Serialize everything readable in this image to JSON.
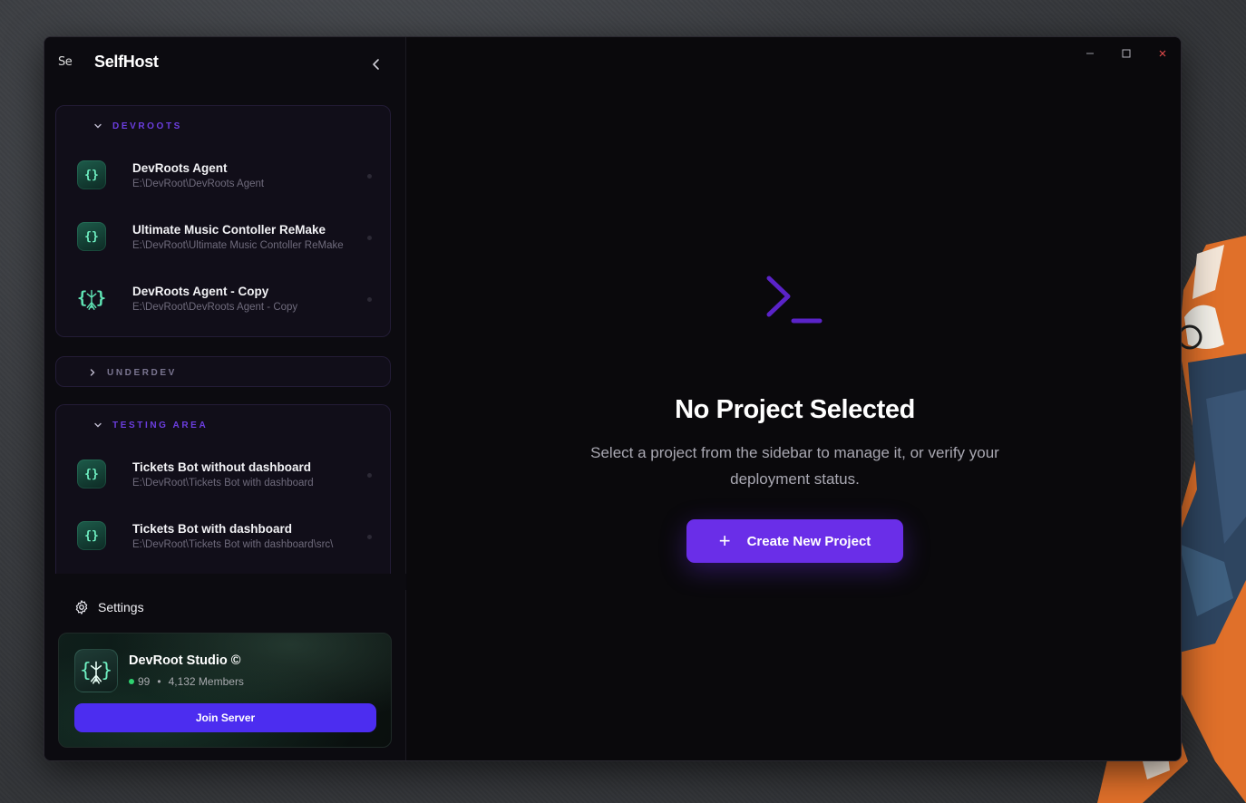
{
  "app": {
    "logo_alt": "Se",
    "title": "SelfHost"
  },
  "window_controls": {
    "minimize": "–",
    "maximize": "□",
    "close": "×"
  },
  "sidebar": {
    "groups": [
      {
        "title": "DEVROOTS",
        "expanded": true,
        "projects": [
          {
            "name": "DevRoots Agent",
            "path": "E:\\DevRoot\\DevRoots Agent",
            "icon": "braces-icon"
          },
          {
            "name": "Ultimate Music Contoller ReMake",
            "path": "E:\\DevRoot\\Ultimate Music Contoller ReMake",
            "icon": "braces-icon"
          },
          {
            "name": "DevRoots Agent - Copy",
            "path": "E:\\DevRoot\\DevRoots Agent - Copy",
            "icon": "devroot-tree-icon"
          }
        ]
      },
      {
        "title": "UNDERDEV",
        "expanded": false,
        "projects": []
      },
      {
        "title": "TESTING AREA",
        "expanded": true,
        "projects": [
          {
            "name": "Tickets Bot without dashboard",
            "path": "E:\\DevRoot\\Tickets Bot with dashboard",
            "icon": "braces-icon"
          },
          {
            "name": "Tickets Bot with dashboard",
            "path": "E:\\DevRoot\\Tickets Bot with dashboard\\src\\",
            "icon": "braces-icon"
          }
        ]
      }
    ],
    "settings_label": "Settings",
    "server_card": {
      "name": "DevRoot Studio ©",
      "online": "99",
      "separator": "•",
      "members": "4,132 Members",
      "join_label": "Join Server"
    }
  },
  "main": {
    "empty_title": "No Project Selected",
    "empty_description": "Select a project from the sidebar to manage it, or verify your deployment status.",
    "create_button_icon": "+",
    "create_button_label": "Create New Project"
  },
  "colors": {
    "accent": "#6a2ee8",
    "join_button": "#4c2df0",
    "group_title": "#6c3ee0",
    "online": "#2fd26f",
    "icon_green": "#6ff0c2"
  }
}
